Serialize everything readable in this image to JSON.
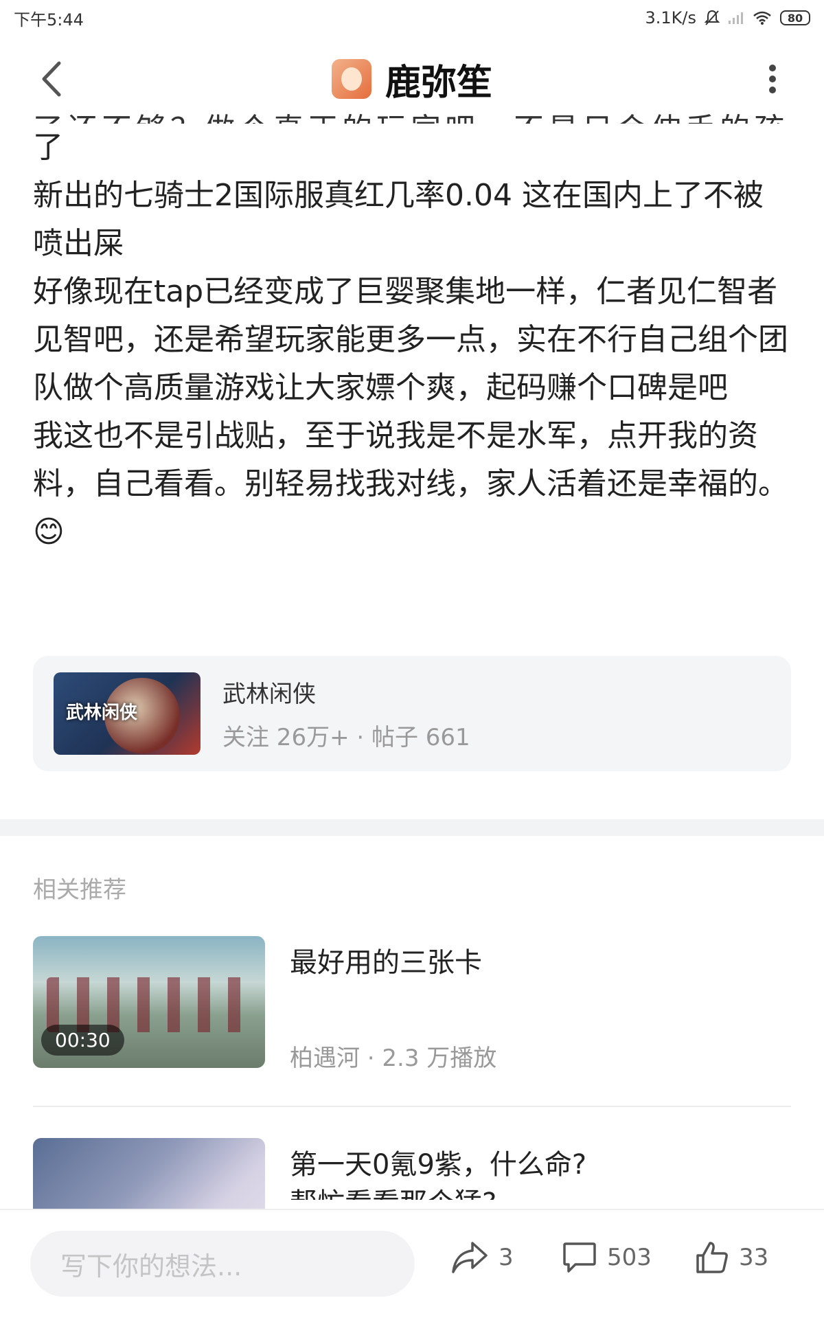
{
  "status_bar": {
    "time": "下午5:44",
    "network_speed": "3.1K/s",
    "battery": "80"
  },
  "header": {
    "title": "鹿弥笙"
  },
  "post": {
    "cut_line": "了还不够？做个真正的玩家吧，不是只会伸手的孩子",
    "paragraphs": [
      "了",
      "新出的七骑士2国际服真红几率0.04   这在国内上了不被喷出屎",
      "好像现在tap已经变成了巨婴聚集地一样，仁者见仁智者见智吧，还是希望玩家能更多一点，实在不行自己组个团队做个高质量游戏让大家嫖个爽，起码赚个口碑是吧",
      "我这也不是引战贴，至于说我是不是水军，点开我的资料，自己看看。别轻易找我对线，家人活着还是幸福的。😊"
    ]
  },
  "forum": {
    "name": "武林闲侠",
    "thumb_text": "武林闲侠",
    "stats": "关注 26万+ · 帖子 661"
  },
  "recommend": {
    "section_title": "相关推荐",
    "items": [
      {
        "title": "最好用的三张卡",
        "meta": "柏遇河 · 2.3 万播放",
        "duration": "00:30"
      },
      {
        "title": "第一天0氪9紫，什么命?",
        "subtitle": "帮忙看看那个猛?"
      }
    ]
  },
  "bottom_bar": {
    "input_placeholder": "写下你的想法...",
    "share_count": "3",
    "comment_count": "503",
    "like_count": "33"
  }
}
